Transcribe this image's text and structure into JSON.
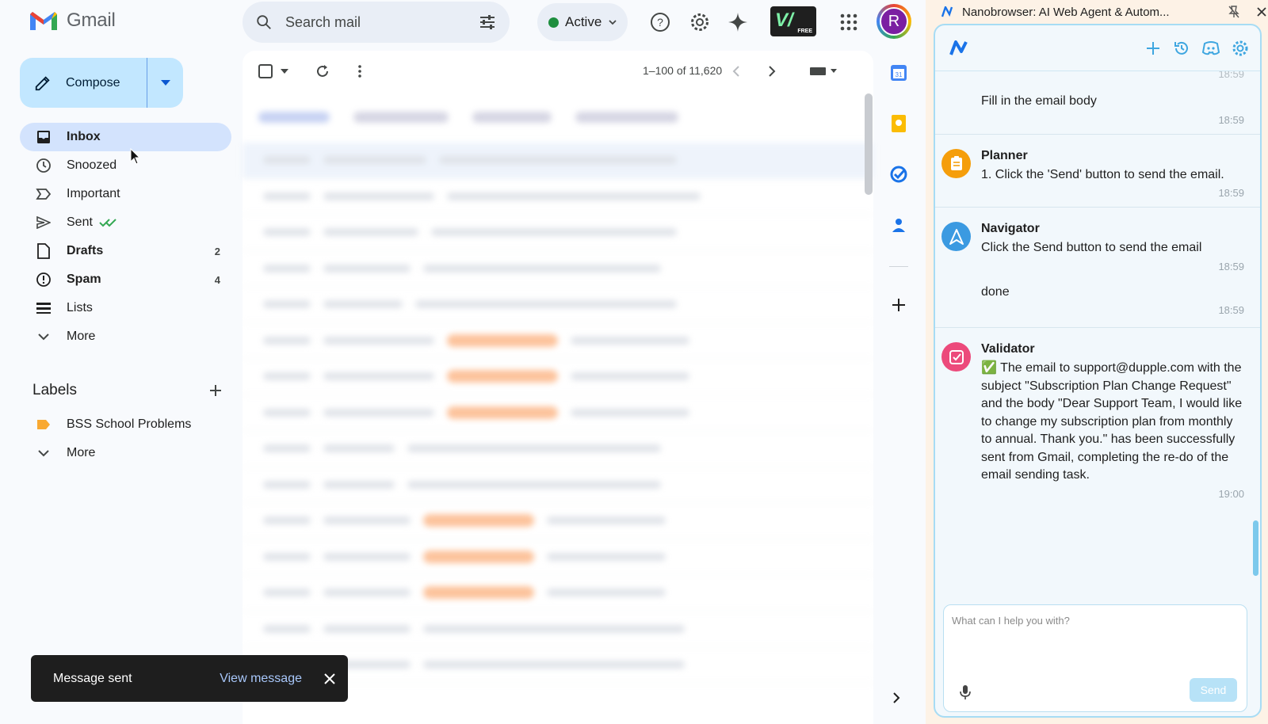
{
  "gmail": {
    "brand": "Gmail",
    "search_placeholder": "Search mail",
    "status": "Active",
    "vw_badge": "V/",
    "vw_badge_sub": "FREE",
    "avatar_initial": "R",
    "compose_label": "Compose",
    "nav": [
      {
        "label": "Inbox",
        "count": "",
        "icon": "inbox-icon"
      },
      {
        "label": "Snoozed",
        "count": "",
        "icon": "clock-icon"
      },
      {
        "label": "Important",
        "count": "",
        "icon": "important-icon"
      },
      {
        "label": "Sent",
        "count": "",
        "icon": "send-icon"
      },
      {
        "label": "Drafts",
        "count": "2",
        "icon": "draft-icon"
      },
      {
        "label": "Spam",
        "count": "4",
        "icon": "spam-icon"
      },
      {
        "label": "Lists",
        "count": "",
        "icon": "list-icon"
      },
      {
        "label": "More",
        "count": "",
        "icon": "chevron-down-icon"
      }
    ],
    "labels_title": "Labels",
    "labels": [
      {
        "label": "BSS School Problems",
        "color": "#f9a932"
      },
      {
        "label": "More",
        "color": ""
      }
    ],
    "pager": "1–100 of 11,620",
    "toast": {
      "message": "Message sent",
      "action": "View message"
    }
  },
  "panel": {
    "window_title": "Nanobrowser: AI Web Agent & Autom...",
    "input_placeholder": "What can I help you with?",
    "send_label": "Send",
    "messages": [
      {
        "agent": "",
        "text": "Fill in the email body",
        "time": "18:59"
      },
      {
        "agent": "Planner",
        "text": "1. Click the 'Send' button to send the email.",
        "time": "18:59"
      },
      {
        "agent": "Navigator",
        "text": "Click the Send button to send the email",
        "time": "18:59"
      },
      {
        "agent": "",
        "text": "done",
        "time": "18:59"
      },
      {
        "agent": "Validator",
        "text": "✅ The email to support@dupple.com with the subject \"Subscription Plan Change Request\" and the body \"Dear Support Team, I would like to change my subscription plan from monthly to annual. Thank you.\" has been successfully sent from Gmail, completing the re-do of the email sending task.",
        "time": "19:00"
      }
    ]
  },
  "colors": {
    "accent": "#0b57d0",
    "compose_bg": "#c2e7ff",
    "nav_selected": "#d3e3fd",
    "panel_border": "#a7dcf4",
    "planner": "#f59e0b",
    "navigator": "#3b9ae1",
    "validator": "#ec4a7b"
  }
}
